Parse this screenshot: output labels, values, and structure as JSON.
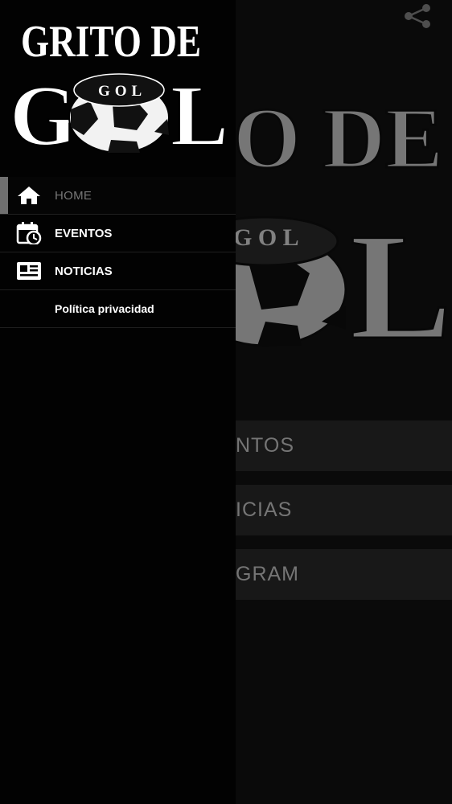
{
  "background": {
    "logo_line1_partial": "O DE",
    "logo_line2_partial": "L",
    "logo_ball_text": "G O L",
    "buttons": [
      {
        "label": "NTOS"
      },
      {
        "label": "ICIAS"
      },
      {
        "label": "GRAM"
      }
    ],
    "share_icon": "share-icon"
  },
  "drawer": {
    "logo": {
      "line1": "GRITO DE",
      "line2_left": "G",
      "line2_right": "L",
      "ball_text": "GOL"
    },
    "menu": [
      {
        "label": "HOME",
        "icon": "home-icon",
        "active": true
      },
      {
        "label": "EVENTOS",
        "icon": "calendar-clock-icon",
        "active": false
      },
      {
        "label": "NOTICIAS",
        "icon": "newspaper-icon",
        "active": false
      },
      {
        "label": "Política privacidad",
        "icon": "",
        "active": false
      }
    ]
  },
  "colors": {
    "drawer_bg": "#020202",
    "active_indicator": "#707070",
    "active_text": "#777777",
    "menu_text": "#ffffff",
    "bg_button": "#1b1b1b",
    "bg_button_text": "#7f7f7f"
  }
}
